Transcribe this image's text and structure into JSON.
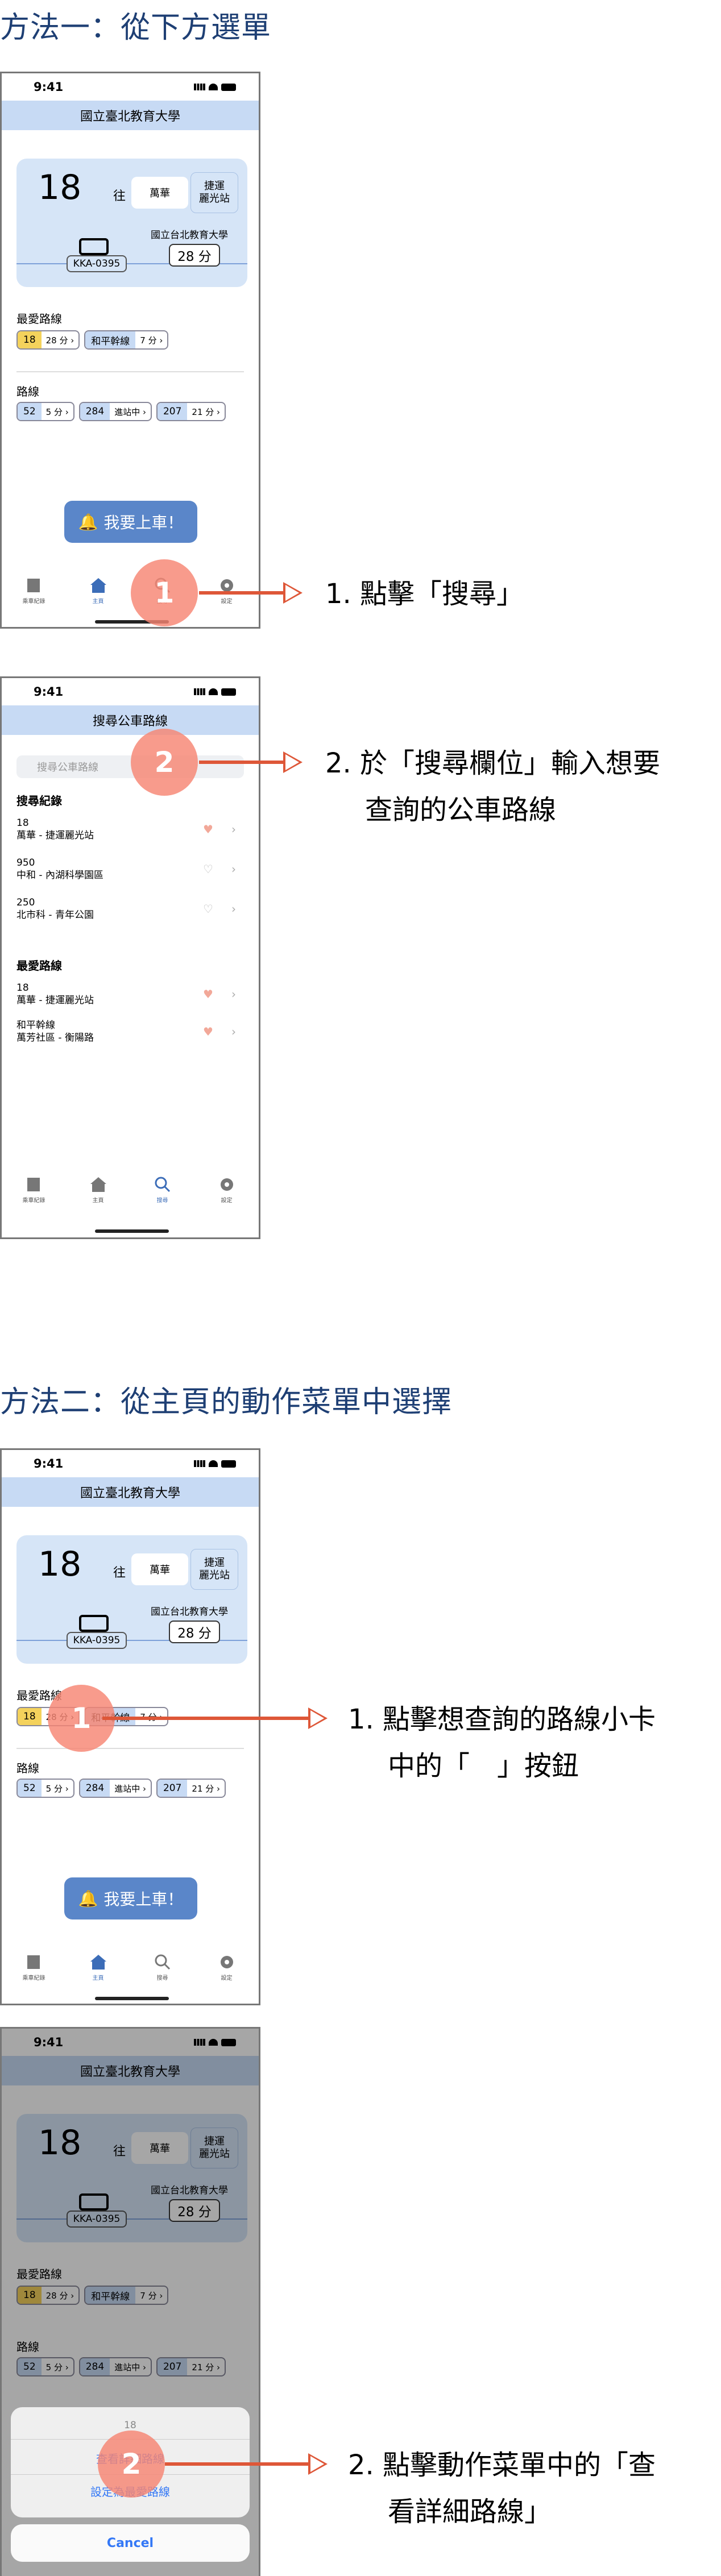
{
  "method1": {
    "title": "方法一：從下方選單",
    "step1_num": "1",
    "step1": "1. 點擊「搜尋」",
    "step2_num": "2",
    "step2_line1": "2. 於「搜尋欄位」輸入想要",
    "step2_line2": "查詢的公車路線"
  },
  "method2": {
    "title": "方法二：從主頁的動作菜單中選擇",
    "step1_num": "1",
    "step1_line1": "1. 點擊想查詢的路線小卡",
    "step1_line2": "中的「　」按鈕",
    "step2_num": "2",
    "step2_line1": "2. 點擊動作菜單中的「查",
    "step2_line2": "看詳細路線」"
  },
  "status": {
    "time": "9:41"
  },
  "home": {
    "nav_title": "國立臺北教育大學",
    "route": "18",
    "to": "往",
    "dest_selected": "萬華",
    "dest_other": "捷運\n麗光站",
    "plate": "KKA-0395",
    "stop": "國立台北教育大學",
    "eta": "28 分",
    "favorites_label": "最愛路線",
    "fav": [
      {
        "n": "18",
        "t": "28 分 ›"
      },
      {
        "n": "和平幹線",
        "t": "7 分 ›"
      }
    ],
    "routes_label": "路線",
    "routes": [
      {
        "n": "52",
        "t": "5 分 ›"
      },
      {
        "n": "284",
        "t": "進站中 ›"
      },
      {
        "n": "207",
        "t": "21 分 ›"
      }
    ],
    "board_button": "我要上車！"
  },
  "tabs": [
    {
      "label": "乘車紀錄"
    },
    {
      "label": "主頁"
    },
    {
      "label": "搜尋"
    },
    {
      "label": "設定"
    }
  ],
  "search": {
    "nav_title": "搜尋公車路線",
    "placeholder": "搜尋公車路線",
    "history_label": "搜尋紀錄",
    "history": [
      {
        "route": "18",
        "desc": "萬華 - 捷運麗光站"
      },
      {
        "route": "950",
        "desc": "中和 - 內湖科學園區"
      },
      {
        "route": "250",
        "desc": "北市科 - 青年公園"
      }
    ],
    "fav_label": "最愛路線",
    "favs": [
      {
        "route": "18",
        "desc": "萬華 - 捷運麗光站"
      },
      {
        "route": "和平幹線",
        "desc": "萬芳社區 - 衡陽路"
      }
    ]
  },
  "sheet": {
    "title": "18",
    "option1": "查看詳細路線",
    "option2": "設定為最愛路線",
    "cancel": "Cancel"
  },
  "colors": {
    "accent": "#de5738",
    "title": "#1e3f74",
    "brand": "#c7daf4"
  }
}
